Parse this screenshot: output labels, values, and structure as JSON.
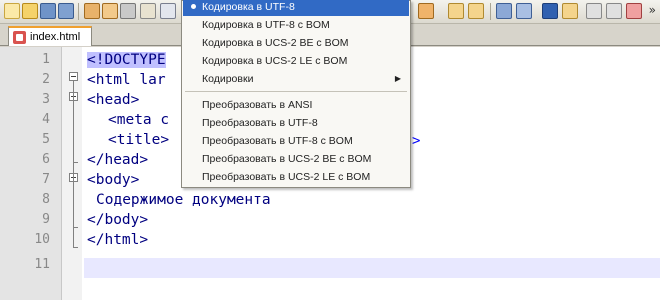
{
  "window": {
    "toolbar_more": "»"
  },
  "tab": {
    "label": "index.html"
  },
  "editor": {
    "lines": [
      {
        "num": "1",
        "code": "<!DOCTYPE"
      },
      {
        "num": "2",
        "code": "<html lar"
      },
      {
        "num": "3",
        "code": "<head>"
      },
      {
        "num": "4",
        "code": "<meta c"
      },
      {
        "num": "5",
        "code": "<title>"
      },
      {
        "num": "6",
        "code": "</head>"
      },
      {
        "num": "7",
        "code": "<body>"
      },
      {
        "num": "8",
        "code": "Содержимое документа"
      },
      {
        "num": "9",
        "code": "</body>"
      },
      {
        "num": "10",
        "code": "</html>"
      },
      {
        "num": "11",
        "code": ""
      }
    ],
    "trailing_glyph": ">"
  },
  "menu": {
    "items": [
      {
        "label": "Кодировка в UTF-8",
        "selected": true
      },
      {
        "label": "Кодировка в UTF-8 с BOM"
      },
      {
        "label": "Кодировка в UCS-2 BE с BOM"
      },
      {
        "label": "Кодировка в UCS-2 LE с BOM"
      },
      {
        "label": "Кодировки",
        "submenu": true
      },
      {
        "label": "Преобразовать в ANSI"
      },
      {
        "label": "Преобразовать в UTF-8"
      },
      {
        "label": "Преобразовать в UTF-8 с BOM"
      },
      {
        "label": "Преобразовать в UCS-2 BE с BOM"
      },
      {
        "label": "Преобразовать в UCS-2 LE с BOM"
      }
    ],
    "submenu_arrow": "▶"
  },
  "colors": {
    "selection": "#316ac5",
    "tag": "#0000ff",
    "attribute": "#ff0000",
    "tab_accent": "#f0a030"
  }
}
